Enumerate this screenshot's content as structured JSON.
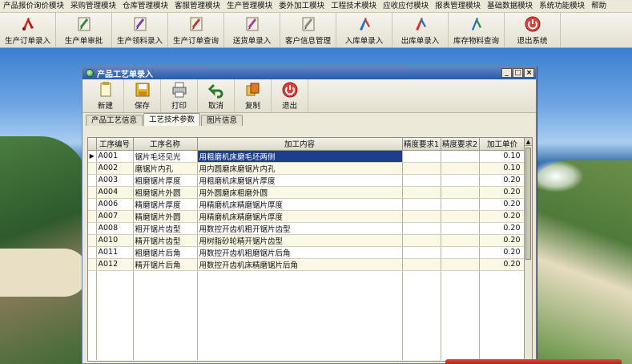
{
  "menubar": {
    "items": [
      "产品报价询价模块",
      "采购管理模块",
      "仓库管理模块",
      "客服管理模块",
      "生产管理模块",
      "委外加工模块",
      "工程技术模块",
      "应收应付模块",
      "报表管理模块",
      "基础数据模块",
      "系统功能模块",
      "帮助"
    ]
  },
  "toolbar": {
    "buttons": [
      {
        "label": "生产订单录入",
        "icon": "pdf-pen-icon"
      },
      {
        "label": "生产单审批",
        "icon": "approval-pen-icon"
      },
      {
        "label": "生产领料录入",
        "icon": "requisition-pen-icon"
      },
      {
        "label": "生产订单查询",
        "icon": "query-pen-icon"
      },
      {
        "label": "送货单录入",
        "icon": "delivery-pen-icon"
      },
      {
        "label": "客户信息管理",
        "icon": "customer-pen-icon"
      },
      {
        "label": "入库单录入",
        "icon": "inbound-pen-icon"
      },
      {
        "label": "出库单录入",
        "icon": "outbound-pen-icon"
      },
      {
        "label": "库存物料查询",
        "icon": "inventory-pen-icon"
      },
      {
        "label": "退出系统",
        "icon": "exit-icon"
      }
    ]
  },
  "window": {
    "title": "产品工艺单录入",
    "controls": {
      "minimize": "_",
      "maximize": "□",
      "close": "×"
    }
  },
  "window_toolbar": {
    "new": "新建",
    "save": "保存",
    "print": "打印",
    "cancel": "取消",
    "copy": "复制",
    "exit": "退出"
  },
  "tabs": [
    "产品工艺信息",
    "工艺技术参数",
    "图片信息"
  ],
  "grid": {
    "columns": [
      "工序编号",
      "工序名称",
      "加工内容",
      "精度要求1",
      "精度要求2",
      "加工单价"
    ],
    "rows": [
      {
        "code": "A001",
        "name": "锯片毛坯见光",
        "content": "用粗磨机床磨毛坯两侧",
        "req1": "",
        "req2": "",
        "price": "0.10"
      },
      {
        "code": "A002",
        "name": "磨锯片内孔",
        "content": "用内圆磨床磨锯片内孔",
        "req1": "",
        "req2": "",
        "price": "0.10"
      },
      {
        "code": "A003",
        "name": "粗磨锯片厚度",
        "content": "用粗磨机床磨锯片厚度",
        "req1": "",
        "req2": "",
        "price": "0.20"
      },
      {
        "code": "A004",
        "name": "粗磨锯片外圆",
        "content": "用外圆磨床粗磨外圆",
        "req1": "",
        "req2": "",
        "price": "0.20"
      },
      {
        "code": "A006",
        "name": "精磨锯片厚度",
        "content": "用精磨机床精磨锯片厚度",
        "req1": "",
        "req2": "",
        "price": "0.20"
      },
      {
        "code": "A007",
        "name": "精磨锯片外圆",
        "content": "用精磨机床精磨锯片厚度",
        "req1": "",
        "req2": "",
        "price": "0.20"
      },
      {
        "code": "A008",
        "name": "粗开锯片齿型",
        "content": "用数控开齿机粗开锯片齿型",
        "req1": "",
        "req2": "",
        "price": "0.20"
      },
      {
        "code": "A010",
        "name": "精开锯片齿型",
        "content": "用树脂砂轮精开锯片齿型",
        "req1": "",
        "req2": "",
        "price": "0.20"
      },
      {
        "code": "A011",
        "name": "粗磨锯片后角",
        "content": "用数控开齿机粗磨锯片后角",
        "req1": "",
        "req2": "",
        "price": "0.20"
      },
      {
        "code": "A012",
        "name": "精开锯片后角",
        "content": "用数控开齿机床精磨锯片后角",
        "req1": "",
        "req2": "",
        "price": "0.20"
      }
    ],
    "current_row_marker": "▶"
  },
  "colors": {
    "selection": "#1e3d8f",
    "titlebar": "#2b5aa8",
    "alt_row": "#fbf8e6"
  }
}
